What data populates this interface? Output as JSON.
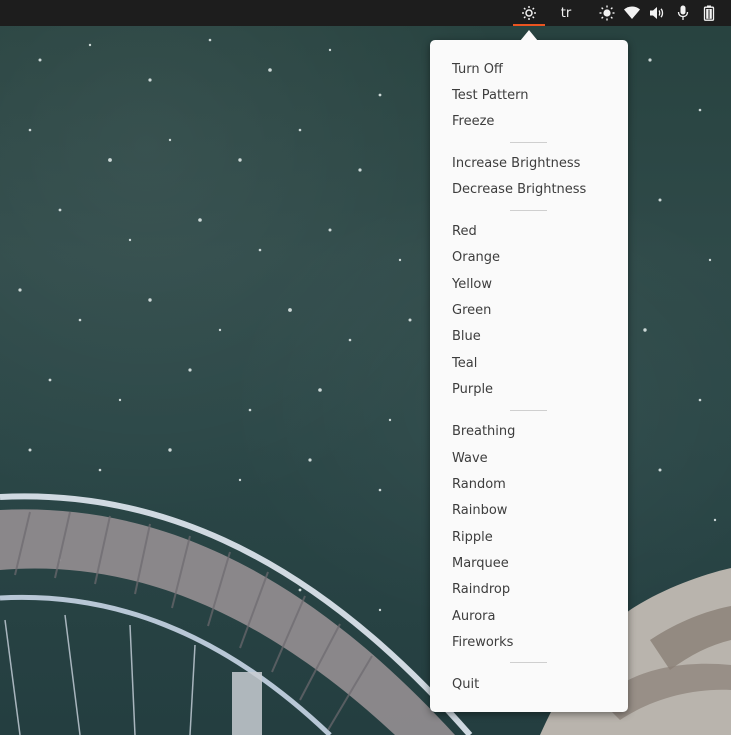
{
  "topbar": {
    "indicators": [
      {
        "name": "brightness-light-icon",
        "active": true
      },
      {
        "name": "keyboard-layout",
        "label": "tr"
      },
      {
        "name": "night-light-icon"
      },
      {
        "name": "wifi-icon"
      },
      {
        "name": "volume-icon"
      },
      {
        "name": "microphone-icon"
      },
      {
        "name": "battery-icon"
      }
    ],
    "accent_color": "#e95420"
  },
  "menu": {
    "sections": [
      [
        "Turn Off",
        "Test Pattern",
        "Freeze"
      ],
      [
        "Increase Brightness",
        "Decrease Brightness"
      ],
      [
        "Red",
        "Orange",
        "Yellow",
        "Green",
        "Blue",
        "Teal",
        "Purple"
      ],
      [
        "Breathing",
        "Wave",
        "Random",
        "Rainbow",
        "Ripple",
        "Marquee",
        "Raindrop",
        "Aurora",
        "Fireworks"
      ],
      [
        "Quit"
      ]
    ]
  }
}
